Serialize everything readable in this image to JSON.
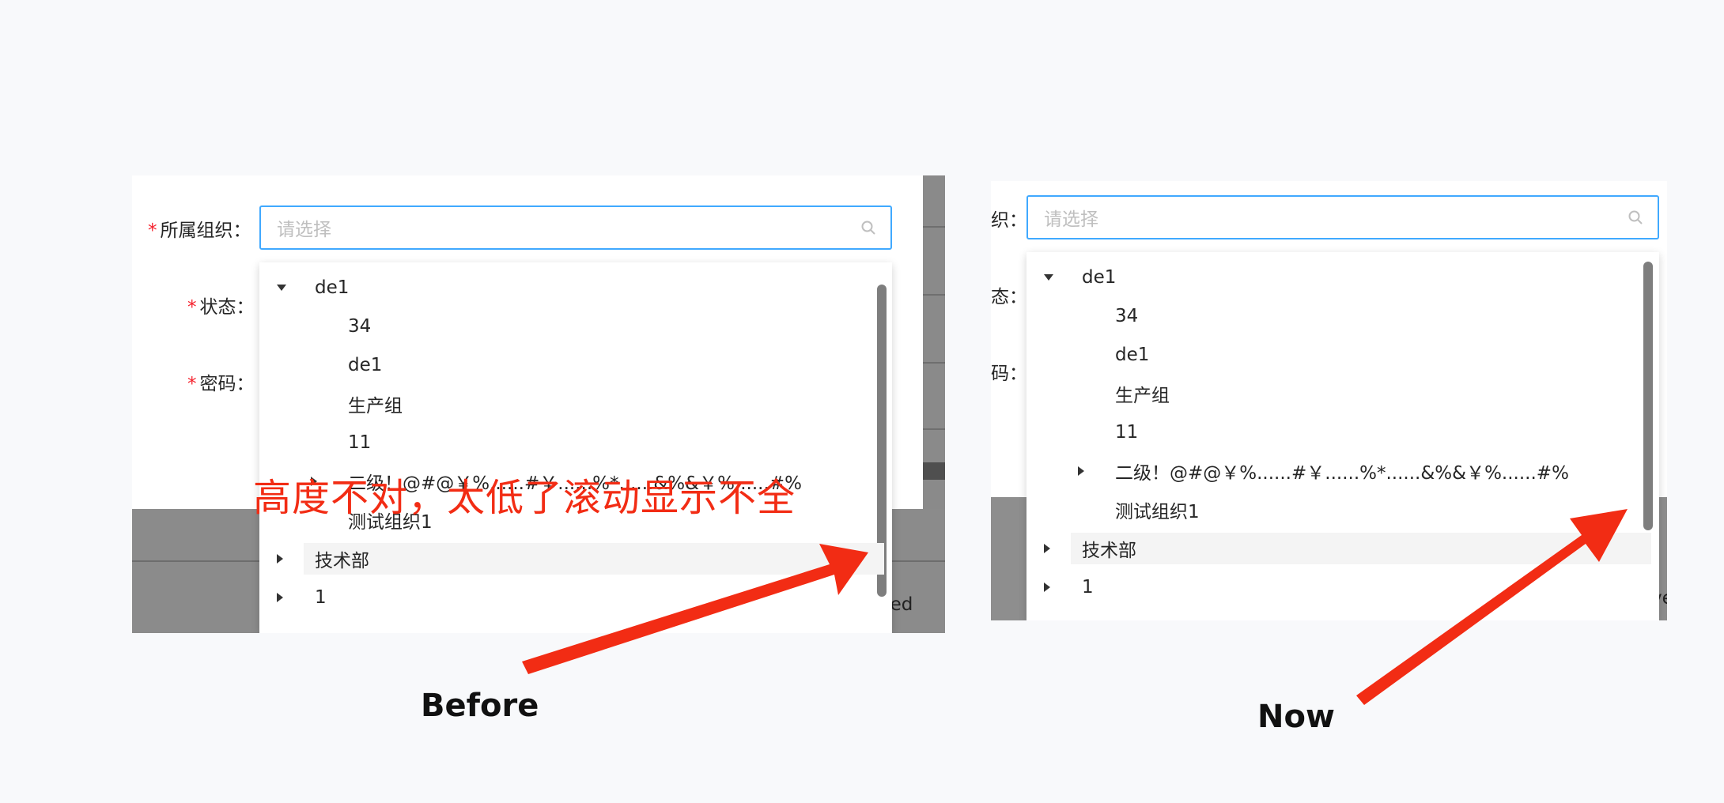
{
  "before": {
    "form": {
      "required_mark": "*",
      "org_label": "所属组织：",
      "status_label": "状态：",
      "password_label": "密码："
    },
    "select": {
      "placeholder": "请选择",
      "icon": "search-icon"
    },
    "tree": [
      {
        "label": "de1",
        "expanded": true
      },
      {
        "label": "34"
      },
      {
        "label": "de1"
      },
      {
        "label": "生产组"
      },
      {
        "label": "11"
      },
      {
        "label": "二级！@#@￥%......#￥......%*......&%&￥%......#%"
      },
      {
        "label": "测试组织1"
      },
      {
        "label": "技术部",
        "highlighted": true
      },
      {
        "label": "1"
      }
    ],
    "footer_fragment": "ved",
    "annotation": "高度不对，太低了滚动显示不全",
    "caption": "Before"
  },
  "now": {
    "form": {
      "org_label_fragment": "织：",
      "status_label_fragment": "态：",
      "password_label_fragment": "码："
    },
    "select": {
      "placeholder": "请选择",
      "icon": "search-icon"
    },
    "tree": [
      {
        "label": "de1",
        "expanded": true
      },
      {
        "label": "34"
      },
      {
        "label": "de1"
      },
      {
        "label": "生产组"
      },
      {
        "label": "11"
      },
      {
        "label": "二级！@#@￥%......#￥......%*......&%&￥%......#%"
      },
      {
        "label": "测试组织1"
      },
      {
        "label": "技术部",
        "highlighted": true
      },
      {
        "label": "1"
      }
    ],
    "footer_fragment": "ve",
    "caption": "Now"
  },
  "colors": {
    "annotation_red": "#f22c14",
    "required_red": "#f5222d",
    "focus_blue": "#40a9ff"
  }
}
